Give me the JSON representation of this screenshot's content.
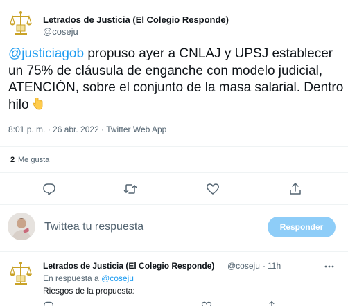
{
  "tweet": {
    "author_name": "Letrados de Justicia (El Colegio Responde)",
    "author_handle": "@coseju",
    "mention": "@justiciagob",
    "text": " propuso ayer a CNLAJ y UPSJ establecer un 75% de cláusula de enganche con modelo judicial, ATENCIÓN, sobre el conjunto de la masa salarial. Dentro hilo",
    "emoji": "pointing-down-hand-emoji",
    "timestamp": "8:01 p. m. · 26 abr. 2022 · Twitter Web App",
    "likes_count": "2",
    "likes_label": "Me gusta"
  },
  "actions": {
    "reply_icon": "reply-icon",
    "retweet_icon": "retweet-icon",
    "like_icon": "heart-icon",
    "share_icon": "share-icon"
  },
  "compose": {
    "placeholder": "Twittea tu respuesta",
    "reply_button": "Responder",
    "button_color": "#8ecdf8"
  },
  "reply_tweet": {
    "author_name": "Letrados de Justicia (El Colegio Responde)",
    "author_handle": "@coseju",
    "separator": "·",
    "time": "11h",
    "replying_prefix": "En respuesta a ",
    "replying_mention": "@coseju",
    "text": "Riesgos de la propuesta:"
  },
  "colors": {
    "accent": "#1d9bf0",
    "logo_gold": "#c9a227",
    "secondary_text": "#536471"
  }
}
